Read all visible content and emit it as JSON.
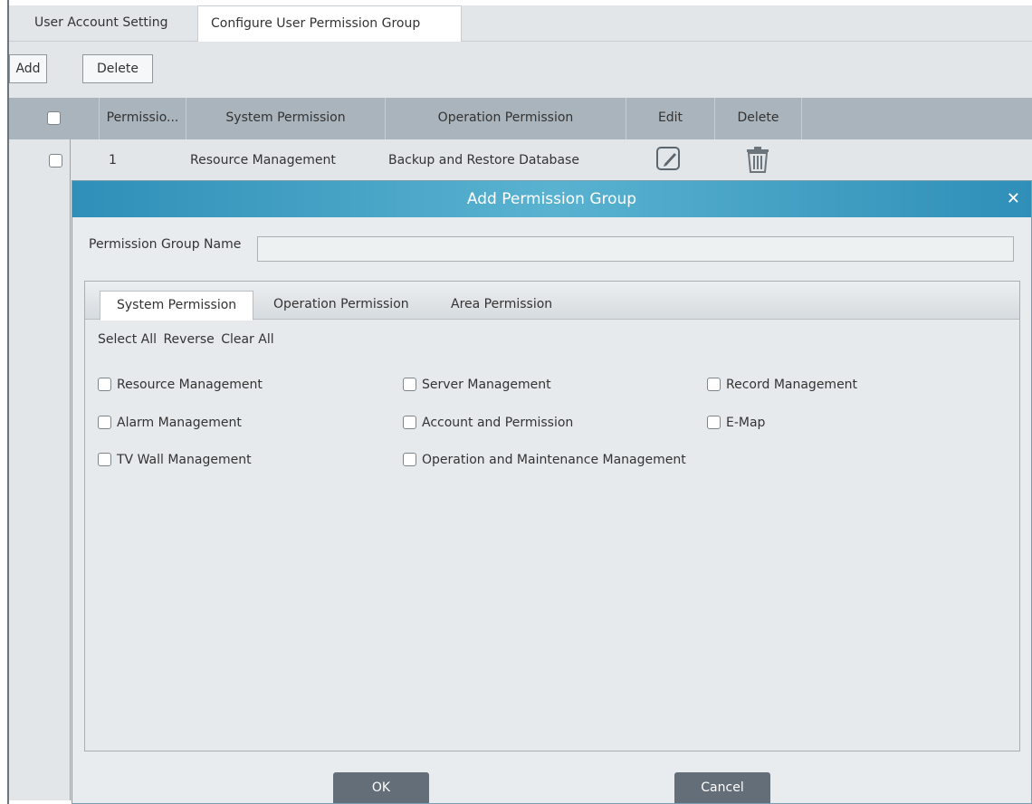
{
  "top_tabs": [
    "User Account Setting",
    "Configure User Permission Group"
  ],
  "toolbar": {
    "add_label": "Add",
    "delete_label": "Delete"
  },
  "table": {
    "headers": [
      "Permissio...",
      "System Permission",
      "Operation Permission",
      "Edit",
      "Delete"
    ],
    "rows": [
      {
        "id": "1",
        "system_permission": "Resource Management",
        "operation_permission": "Backup and Restore Database"
      }
    ]
  },
  "dialog": {
    "title": "Add Permission Group",
    "close_glyph": "✕",
    "name_label": "Permission Group Name",
    "name_value": "",
    "tabs": [
      "System Permission",
      "Operation Permission",
      "Area Permission"
    ],
    "select_actions": [
      "Select All",
      "Reverse",
      "Clear All"
    ],
    "permissions": [
      "Resource Management",
      "Server Management",
      "Record Management",
      "Alarm Management",
      "Account and Permission",
      "E-Map",
      "TV Wall Management",
      "Operation and Maintenance Management"
    ],
    "ok_label": "OK",
    "cancel_label": "Cancel"
  },
  "icons": {
    "edit": "edit-icon",
    "delete": "trash-icon",
    "close": "close-icon"
  },
  "colors": {
    "dialog_header": "#3aa0c4",
    "table_header": "#a9b4bd",
    "button_dark": "#646e78"
  }
}
